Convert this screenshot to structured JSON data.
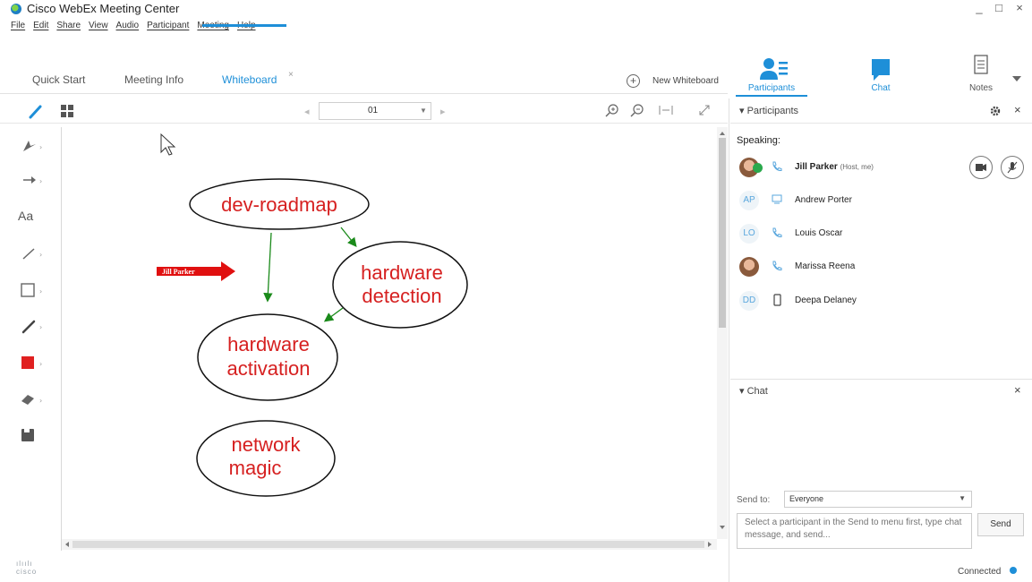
{
  "window": {
    "title": "Cisco WebEx Meeting Center",
    "minimize": "_",
    "maximize": "□",
    "close": "×"
  },
  "menu": [
    "File",
    "Edit",
    "Share",
    "View",
    "Audio",
    "Participant",
    "Meeting",
    "Help"
  ],
  "tabs": [
    {
      "label": "Quick Start",
      "active": false
    },
    {
      "label": "Meeting Info",
      "active": false
    },
    {
      "label": "Whiteboard",
      "active": true
    }
  ],
  "tab_close": "×",
  "new_whiteboard": "New Whiteboard",
  "panel_tabs": [
    {
      "label": "Participants",
      "icon": "participants-icon",
      "active": true
    },
    {
      "label": "Chat",
      "icon": "chat-bubble-icon",
      "active": false
    },
    {
      "label": "Notes",
      "icon": "notes-icon",
      "active": false
    }
  ],
  "page_selector": {
    "value": "01"
  },
  "whiteboard": {
    "annotation_pointer": "Jill Parker",
    "nodes": [
      "dev-roadmap",
      "hardware detection",
      "hardware activation",
      "network magic"
    ],
    "node_lines": [
      [
        "dev-roadmap"
      ],
      [
        "hardware",
        "detection"
      ],
      [
        "hardware",
        "activation"
      ],
      [
        "network",
        "magic"
      ]
    ],
    "accent_color": "#e02020",
    "arrow_color": "#1a8a1a"
  },
  "participants_panel": {
    "title": "Participants",
    "speaking_label": "Speaking:",
    "people": [
      {
        "name": "Jill Parker",
        "note": "(Host, me)",
        "initials": "",
        "device": "phone-icon",
        "photo": true,
        "bold": true
      },
      {
        "name": "Andrew Porter",
        "note": "",
        "initials": "AP",
        "device": "computer-icon",
        "photo": false,
        "bold": false
      },
      {
        "name": "Louis Oscar",
        "note": "",
        "initials": "LO",
        "device": "phone-icon",
        "photo": false,
        "bold": false
      },
      {
        "name": "Marissa Reena",
        "note": "",
        "initials": "",
        "device": "phone-icon",
        "photo": true,
        "bold": false
      },
      {
        "name": "Deepa Delaney",
        "note": "",
        "initials": "DD",
        "device": "mobile-icon",
        "photo": false,
        "bold": false
      }
    ]
  },
  "chat_panel": {
    "title": "Chat",
    "send_to_label": "Send to:",
    "send_to_value": "Everyone",
    "input_placeholder": "Select a participant in the Send to menu first, type chat message, and send...",
    "send_button": "Send"
  },
  "footer": {
    "brand": "cisco",
    "status": "Connected"
  }
}
